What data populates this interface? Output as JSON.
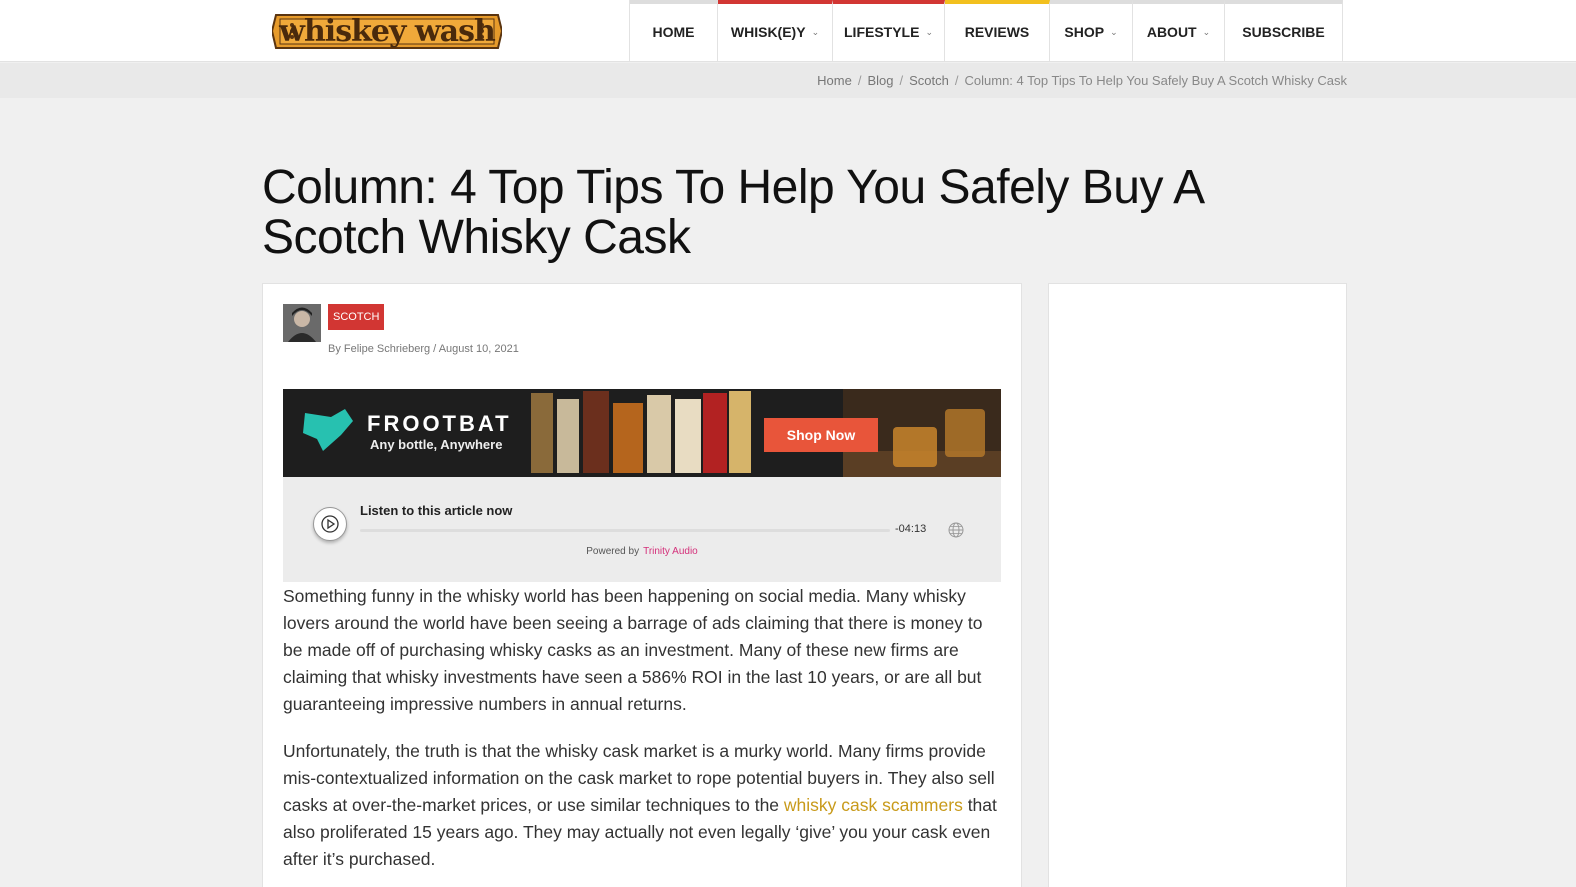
{
  "site": {
    "logo_text": "whiskey wash"
  },
  "nav": {
    "items": [
      {
        "label": "HOME",
        "dropdown": false
      },
      {
        "label": "WHISK(E)Y",
        "dropdown": true
      },
      {
        "label": "LIFESTYLE",
        "dropdown": true
      },
      {
        "label": "REVIEWS",
        "dropdown": false
      },
      {
        "label": "SHOP",
        "dropdown": true
      },
      {
        "label": "ABOUT",
        "dropdown": true
      },
      {
        "label": "SUBSCRIBE",
        "dropdown": false
      }
    ]
  },
  "breadcrumb": {
    "items": [
      "Home",
      "Blog",
      "Scotch"
    ],
    "current": "Column: 4 Top Tips To Help You Safely Buy A Scotch Whisky Cask"
  },
  "article": {
    "title": "Column: 4 Top Tips To Help You Safely Buy A Scotch Whisky Cask",
    "category": "SCOTCH",
    "byline_prefix": "By",
    "author": "Felipe Schrieberg",
    "date": "August 10, 2021",
    "paragraph1": "Something funny in the whisky world has been happening on social media. Many whisky lovers around the world have been seeing a barrage of ads claiming that there is money to be made off of purchasing whisky casks as an investment. Many of these new firms are claiming that whisky investments have seen a 586% ROI in the last 10 years, or are all but guaranteeing impressive numbers in annual returns.",
    "paragraph2_before": "Unfortunately, the truth is that the whisky cask market is a murky world. Many firms provide mis-contextualized information on the cask market to rope potential buyers in. They also sell casks at over-the-market prices, or use similar techniques to the ",
    "paragraph2_link": "whisky cask scammers",
    "paragraph2_after": " that also proliferated 15 years ago. They may actually not even legally ‘give’ you your cask even after it’s purchased."
  },
  "ad": {
    "brand": "FROOTBAT",
    "tagline": "Any bottle, Anywhere",
    "cta": "Shop Now"
  },
  "audio": {
    "label": "Listen to this article now",
    "time": "-04:13",
    "powered_by": "Powered by",
    "provider": "Trinity Audio"
  },
  "colors": {
    "accent_red": "#d23633",
    "accent_yellow": "#f2c01e",
    "link": "#c89a1a"
  }
}
